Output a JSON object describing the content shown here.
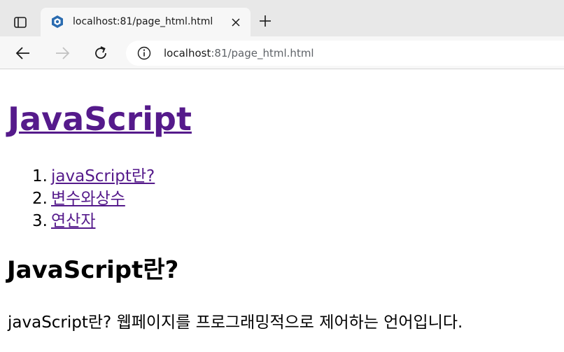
{
  "browser": {
    "tab": {
      "title": "localhost:81/page_html.html"
    },
    "address_bar": {
      "host": "localhost",
      "rest": ":81/page_html.html"
    },
    "colors": {
      "tabstrip_bg": "#e8e8e8",
      "toolbar_bg": "#f7f7f7",
      "favicon": "#2b6cb0"
    },
    "icons": [
      "tab-actions-icon",
      "favicon-icon",
      "close-icon",
      "plus-icon",
      "back-arrow-icon",
      "forward-arrow-icon",
      "reload-icon",
      "info-icon"
    ]
  },
  "page": {
    "title": "JavaScript",
    "toc": [
      {
        "number": "1.",
        "label": "javaScript란?"
      },
      {
        "number": "2.",
        "label": "변수와상수"
      },
      {
        "number": "3.",
        "label": "연산자"
      }
    ],
    "section": {
      "heading": "JavaScript란?",
      "text": "javaScript란? 웹페이지를 프로그래밍적으로 제어하는 언어입니다."
    },
    "colors": {
      "link_visited": "#551a8b",
      "text": "#000000"
    }
  }
}
